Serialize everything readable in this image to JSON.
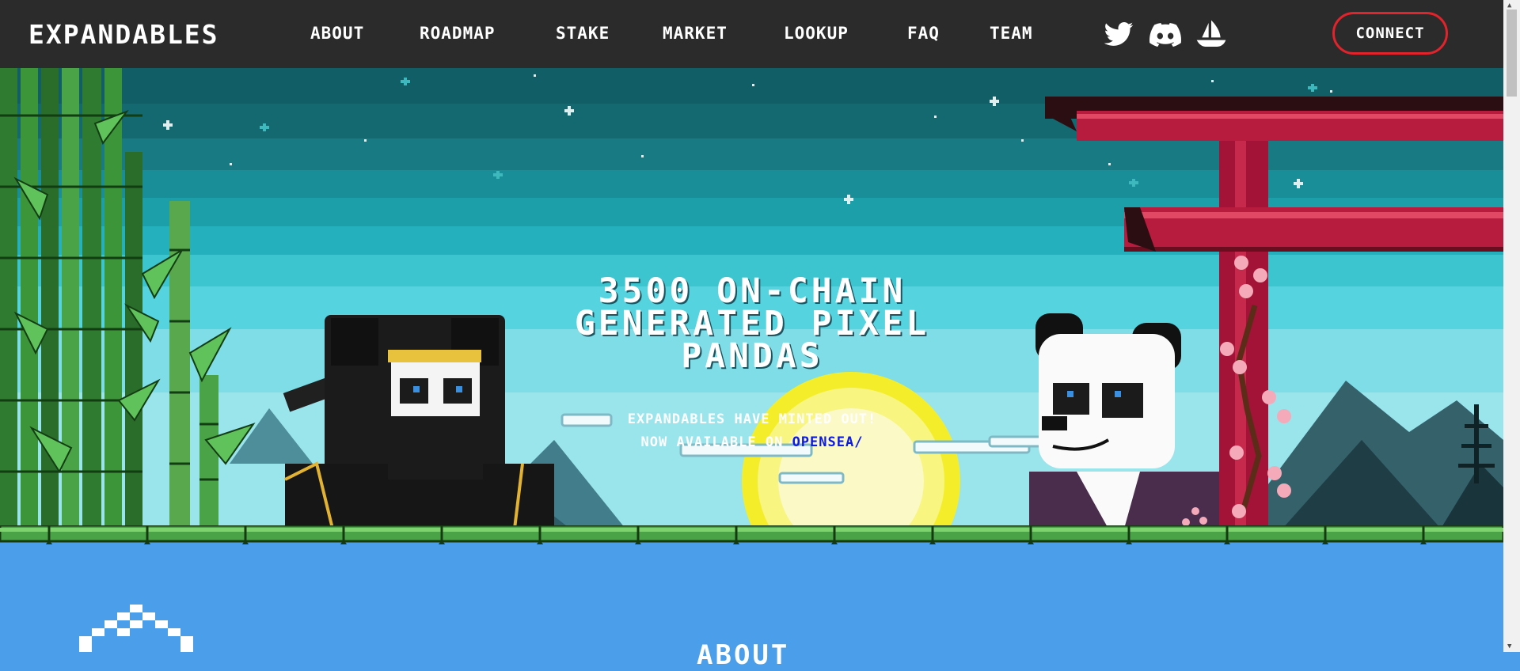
{
  "brand": "EXPANDABLES",
  "nav": [
    {
      "label": "ABOUT"
    },
    {
      "label": "ROADMAP"
    },
    {
      "label": "STAKE"
    },
    {
      "label": "MARKET"
    },
    {
      "label": "LOOKUP"
    },
    {
      "label": "FAQ"
    },
    {
      "label": "TEAM"
    }
  ],
  "social": [
    {
      "icon": "twitter-icon"
    },
    {
      "icon": "discord-icon"
    },
    {
      "icon": "opensea-icon"
    }
  ],
  "connect_label": "CONNECT",
  "hero": {
    "headline_1": "3500 ON-CHAIN",
    "headline_2": "GENERATED PIXEL",
    "headline_3": "PANDAS",
    "minted_text": "EXPANDABLES HAVE MINTED OUT!",
    "available_prefix": "NOW AVAILABLE ON",
    "opensea_link": "OPENSEA/"
  },
  "about": {
    "title": "ABOUT"
  },
  "colors": {
    "nav_bg": "#2b2b2b",
    "connect_border": "#e2232b",
    "link_blue": "#0a18e8",
    "section_blue": "#4a9eea"
  }
}
